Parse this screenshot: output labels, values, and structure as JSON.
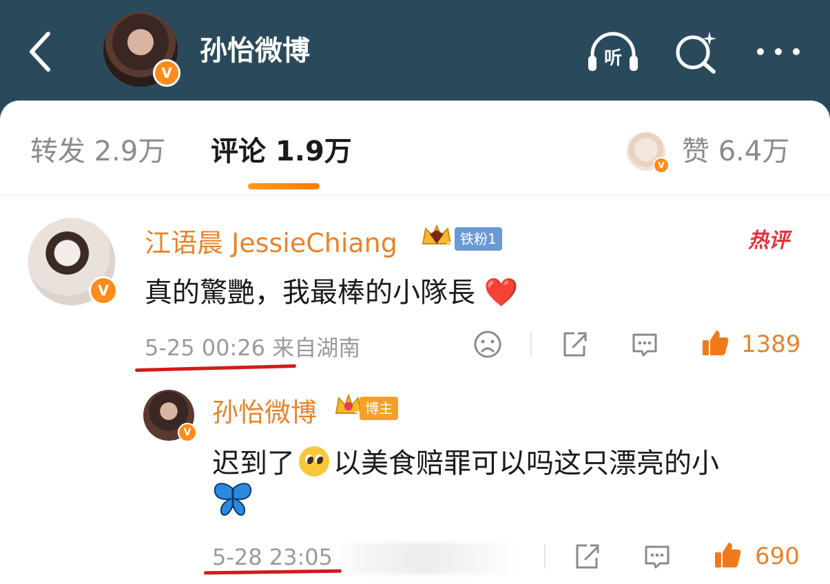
{
  "header": {
    "title": "孙怡微博",
    "listen_label": "听"
  },
  "tabs": {
    "repost": "转发 2.9万",
    "comment": "评论 1.9万",
    "like": "赞 6.4万"
  },
  "comments": [
    {
      "author": "江语晨 JessieChiang",
      "fan_badge": "铁粉1",
      "crown_level": "2",
      "hot_label": "热评",
      "text": "真的驚艷，我最棒的小隊長",
      "emoji": "❤️",
      "meta": "5-25 00:26  来自湖南",
      "likes": "1389"
    }
  ],
  "reply": {
    "author": "孙怡微博",
    "host_badge": "博主",
    "crown_level": "7",
    "text_before": "迟到了",
    "text_after": "以美食赔罪可以吗这只漂亮的小",
    "meta": "5-28 23:05",
    "likes": "690"
  },
  "badge_letter": "V",
  "colors": {
    "header_bg": "#2a4a5c",
    "accent_orange": "#e8832a",
    "hot_red": "#e8303a",
    "annotation_red": "#d11a1a"
  }
}
